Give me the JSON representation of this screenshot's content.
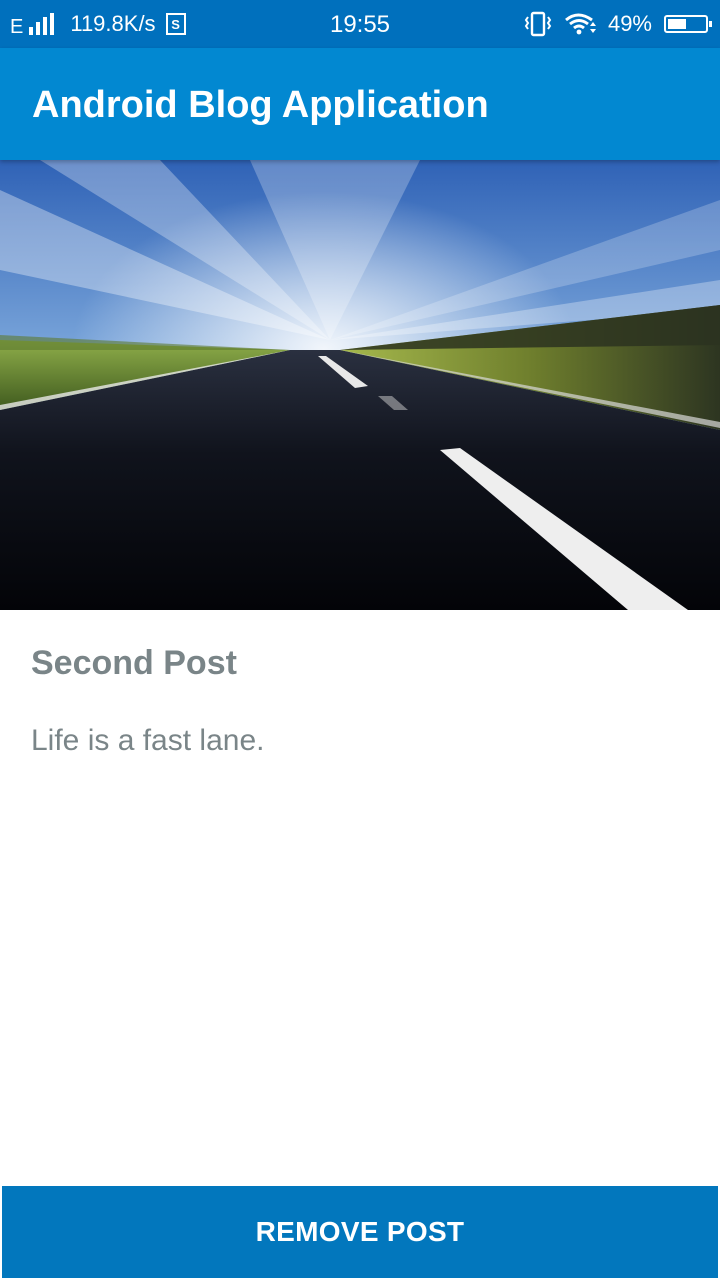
{
  "status_bar": {
    "network": "E",
    "speed": "119.8K/s",
    "s_badge": "S",
    "time": "19:55",
    "battery_text": "49%",
    "battery_level": 0.49,
    "icons": [
      "signal-icon",
      "storage-s-icon",
      "vibrate-icon",
      "wifi-icon",
      "battery-icon"
    ]
  },
  "app_bar": {
    "title": "Android Blog Application",
    "color": "#0288d1"
  },
  "post": {
    "image": "road-photo",
    "title": "Second Post",
    "body": "Life is a fast lane."
  },
  "actions": {
    "remove_label": "REMOVE POST",
    "color": "#0277bd"
  }
}
